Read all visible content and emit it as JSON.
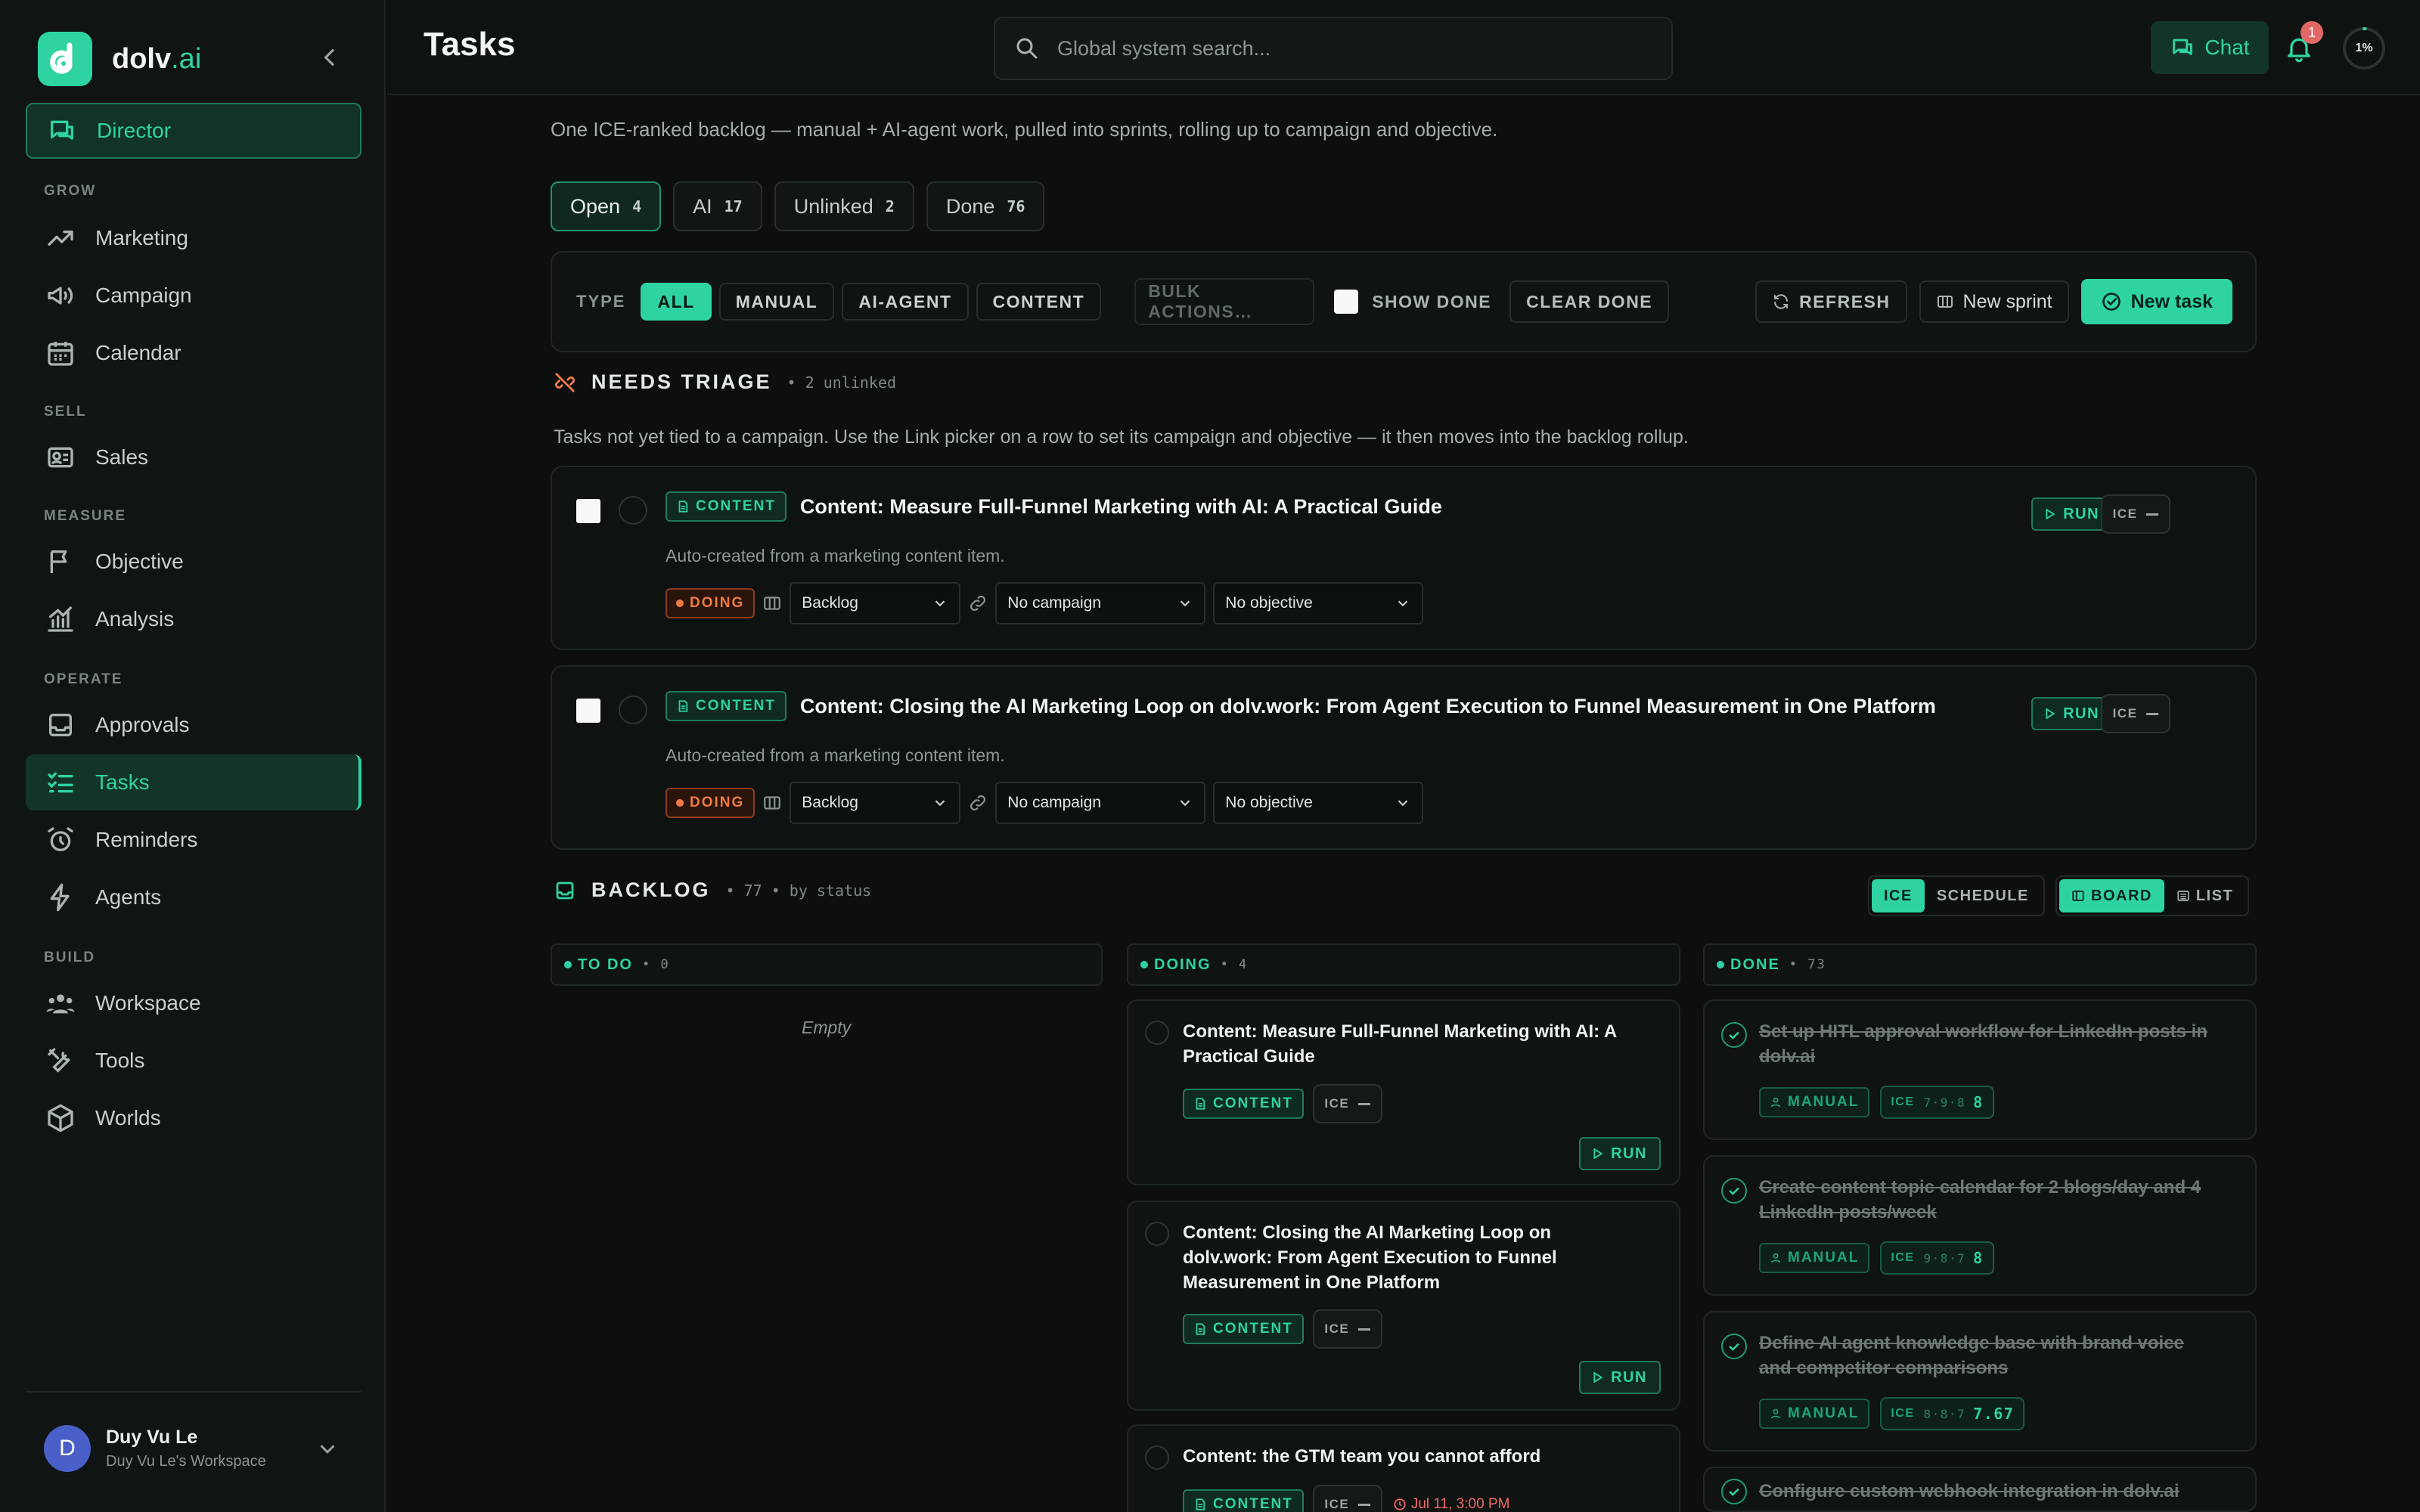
{
  "brand": {
    "name": "dolv",
    "suffix": ".ai"
  },
  "sidebar": {
    "director": "Director",
    "sections": {
      "grow": "GROW",
      "sell": "SELL",
      "measure": "MEASURE",
      "operate": "OPERATE",
      "build": "BUILD"
    },
    "items": {
      "marketing": "Marketing",
      "campaign": "Campaign",
      "calendar": "Calendar",
      "sales": "Sales",
      "objective": "Objective",
      "analysis": "Analysis",
      "approvals": "Approvals",
      "tasks": "Tasks",
      "reminders": "Reminders",
      "agents": "Agents",
      "workspace": "Workspace",
      "tools": "Tools",
      "worlds": "Worlds"
    },
    "user": {
      "initial": "D",
      "name": "Duy Vu Le",
      "workspace": "Duy Vu Le's Workspace"
    }
  },
  "header": {
    "title": "Tasks",
    "search_placeholder": "Global system search...",
    "chat_label": "Chat",
    "notification_count": "1",
    "progress_label": "1%",
    "progress_value": 0.01
  },
  "main": {
    "subtitle": "One ICE-ranked backlog — manual + AI-agent work, pulled into sprints, rolling up to campaign and objective.",
    "tabs": [
      {
        "label": "Open",
        "count": "4"
      },
      {
        "label": "AI",
        "count": "17"
      },
      {
        "label": "Unlinked",
        "count": "2"
      },
      {
        "label": "Done",
        "count": "76"
      }
    ],
    "toolbar": {
      "type_label": "TYPE",
      "types": [
        "ALL",
        "MANUAL",
        "AI-AGENT",
        "CONTENT"
      ],
      "bulk_label": "BULK ACTIONS…",
      "show_done": "SHOW DONE",
      "clear_done": "CLEAR DONE",
      "refresh": "REFRESH",
      "new_sprint": "New sprint",
      "new_task": "New task"
    },
    "triage": {
      "title": "NEEDS TRIAGE",
      "meta": "• 2 unlinked",
      "description": "Tasks not yet tied to a campaign. Use the Link picker on a row to set its campaign and objective — it then moves into the backlog rollup.",
      "tasks": [
        {
          "type": "CONTENT",
          "title": "Content: Measure Full-Funnel Marketing with AI: A Practical Guide",
          "description": "Auto-created from a marketing content item.",
          "status": "DOING",
          "sprint": "Backlog",
          "campaign": "No campaign",
          "objective": "No objective",
          "run": "RUN",
          "ice": "ICE"
        },
        {
          "type": "CONTENT",
          "title": "Content: Closing the AI Marketing Loop on dolv.work: From Agent Execution to Funnel Measurement in One Platform",
          "description": "Auto-created from a marketing content item.",
          "status": "DOING",
          "sprint": "Backlog",
          "campaign": "No campaign",
          "objective": "No objective",
          "run": "RUN",
          "ice": "ICE"
        }
      ]
    },
    "backlog": {
      "title": "BACKLOG",
      "meta": "• 77 • by status",
      "sort": [
        "ICE",
        "SCHEDULE"
      ],
      "views": [
        "BOARD",
        "LIST"
      ],
      "columns": [
        {
          "label": "TO DO",
          "count": "• 0",
          "empty": "Empty"
        },
        {
          "label": "DOING",
          "count": "• 4"
        },
        {
          "label": "DONE",
          "count": "• 73"
        }
      ],
      "doing": [
        {
          "title": "Content: Measure Full-Funnel Marketing with AI: A Practical Guide",
          "type": "CONTENT",
          "ice": "ICE",
          "run": "RUN"
        },
        {
          "title": "Content: Closing the AI Marketing Loop on dolv.work: From Agent Execution to Funnel Measurement in One Platform",
          "type": "CONTENT",
          "ice": "ICE",
          "run": "RUN"
        },
        {
          "title": "Content: the GTM team you cannot afford",
          "type": "CONTENT",
          "ice": "ICE",
          "date": "Jul 11, 3:00 PM"
        }
      ],
      "done": [
        {
          "title": "Set up HITL approval workflow for LinkedIn posts in dolv.ai",
          "type": "MANUAL",
          "ice_label": "ICE",
          "ice_parts": "7·9·8",
          "ice_total": "8"
        },
        {
          "title": "Create content topic calendar for 2 blogs/day and 4 LinkedIn posts/week",
          "type": "MANUAL",
          "ice_label": "ICE",
          "ice_parts": "9·8·7",
          "ice_total": "8"
        },
        {
          "title": "Define AI agent knowledge base with brand voice and competitor comparisons",
          "type": "MANUAL",
          "ice_label": "ICE",
          "ice_parts": "8·8·7",
          "ice_total": "7.67"
        },
        {
          "title": "Configure custom webhook integration in dolv.ai"
        }
      ]
    }
  }
}
